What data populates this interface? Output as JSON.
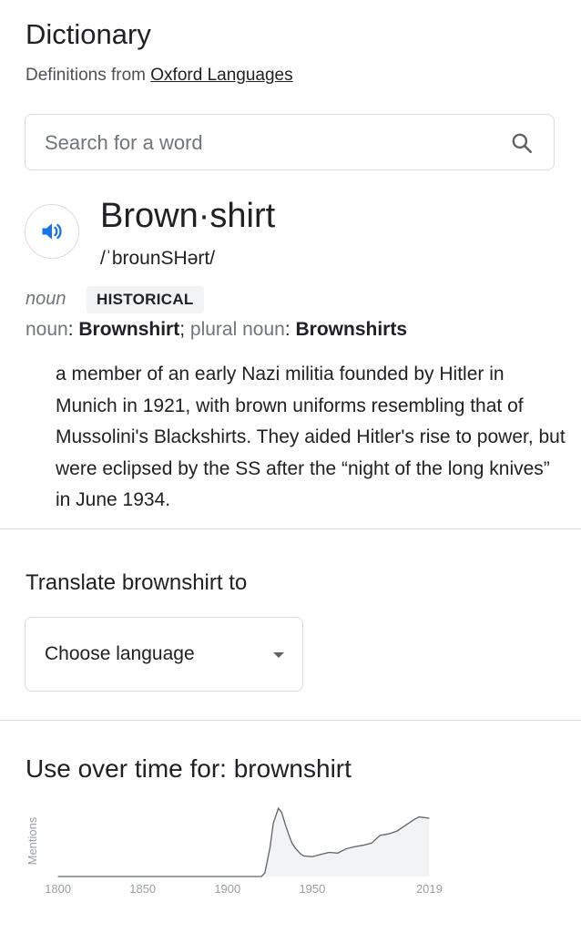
{
  "header": {
    "title": "Dictionary",
    "subtitle_prefix": "Definitions from ",
    "subtitle_link": "Oxford Languages"
  },
  "search": {
    "placeholder": "Search for a word",
    "icon": "search-icon"
  },
  "entry": {
    "speaker_icon": "speaker-icon",
    "word": "Brown·shirt",
    "phonetic": "/ˈbrounSHərt/",
    "part_of_speech": "noun",
    "label": "HISTORICAL",
    "forms": {
      "noun_prefix": "noun",
      "noun_value": "Brownshirt",
      "plural_prefix": "plural noun",
      "plural_value": "Brownshirts"
    },
    "definition": "a member of an early Nazi militia founded by Hitler in Munich in 1921, with brown uniforms resembling that of Mussolini's Blackshirts. They aided Hitler's rise to power, but were eclipsed by the SS after the “night of the long knives” in June 1934."
  },
  "translate": {
    "heading": "Translate brownshirt to",
    "select_value": "Choose language",
    "chevron_icon": "chevron-down-icon"
  },
  "usage": {
    "heading": "Use over time for: brownshirt"
  },
  "chart_data": {
    "type": "area",
    "ylabel": "Mentions",
    "xlabel": "",
    "tick_labels": [
      "1800",
      "1850",
      "1900",
      "1950",
      "2019"
    ],
    "tick_values": [
      1800,
      1850,
      1900,
      1950,
      2019
    ],
    "xlim": [
      1790,
      2029
    ],
    "ylim": [
      0,
      100
    ],
    "grid": false,
    "fill_color": "#f1f3f4",
    "line_color": "#5f6368",
    "x": [
      1800,
      1920,
      1922,
      1925,
      1927,
      1930,
      1932,
      1934,
      1936,
      1938,
      1940,
      1943,
      1945,
      1950,
      1955,
      1960,
      1965,
      1970,
      1975,
      1980,
      1985,
      1990,
      1995,
      2000,
      2005,
      2010,
      2013,
      2016,
      2019
    ],
    "y": [
      0,
      0,
      5,
      40,
      75,
      96,
      90,
      74,
      60,
      47,
      40,
      32,
      29,
      28,
      31,
      34,
      33,
      39,
      42,
      44,
      47,
      58,
      60,
      64,
      72,
      80,
      84,
      83,
      82
    ]
  }
}
